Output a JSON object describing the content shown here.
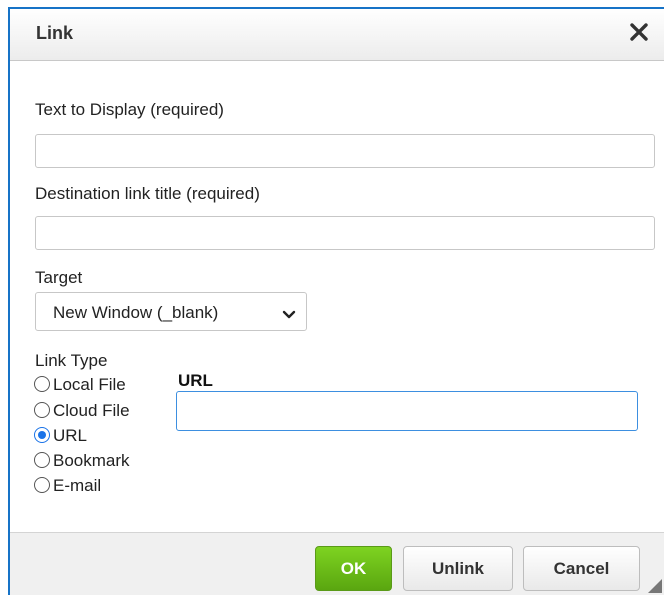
{
  "dialog": {
    "title": "Link",
    "close_icon": "close-icon"
  },
  "fields": {
    "text_to_display": {
      "label": "Text to Display (required)",
      "value": ""
    },
    "destination_title": {
      "label": "Destination link title (required)",
      "value": ""
    }
  },
  "target": {
    "label": "Target",
    "selected": "New Window (_blank)",
    "arrow_icon": "chevron-down-icon"
  },
  "link_type": {
    "label": "Link Type",
    "options": [
      {
        "label": "Local File",
        "checked": false
      },
      {
        "label": "Cloud File",
        "checked": false
      },
      {
        "label": "URL",
        "checked": true
      },
      {
        "label": "Bookmark",
        "checked": false
      },
      {
        "label": "E-mail",
        "checked": false
      }
    ]
  },
  "url": {
    "label": "URL",
    "value": ""
  },
  "footer": {
    "ok_label": "OK",
    "unlink_label": "Unlink",
    "cancel_label": "Cancel",
    "resize_icon": "resize-grip-icon"
  },
  "colors": {
    "accent_border": "#1673c7",
    "ok_green": "#6cc218",
    "focus_blue": "#3d8fe0"
  }
}
